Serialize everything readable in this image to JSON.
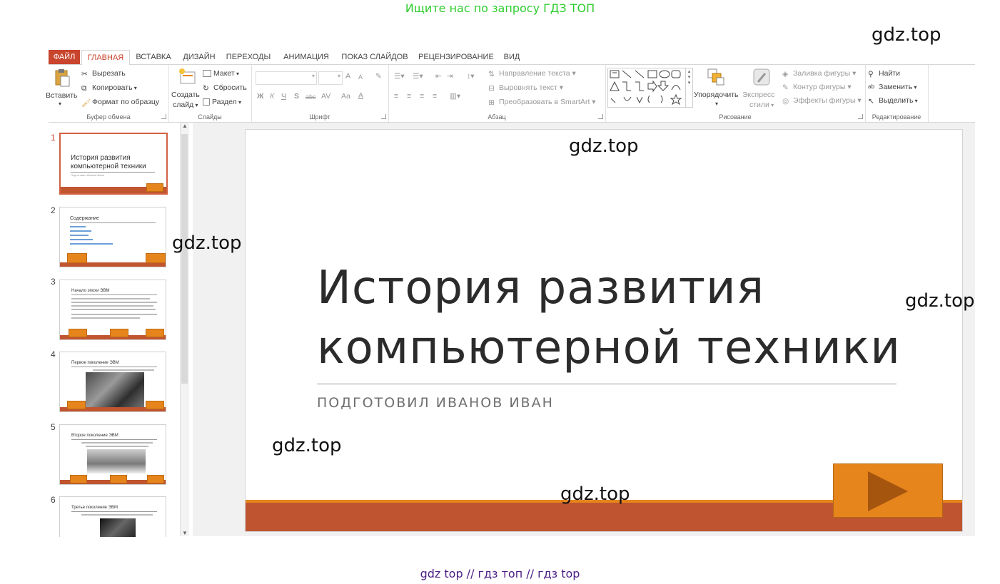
{
  "banner_top": "Ищите нас по запросу ГДЗ ТОП",
  "banner_bottom": "gdz top  //  гдз топ  //  гдз top",
  "watermark": "gdz.top",
  "ribbon": {
    "tabs": [
      "ФАЙЛ",
      "ГЛАВНАЯ",
      "ВСТАВКА",
      "ДИЗАЙН",
      "ПЕРЕХОДЫ",
      "АНИМАЦИЯ",
      "ПОКАЗ СЛАЙДОВ",
      "РЕЦЕНЗИРОВАНИЕ",
      "ВИД"
    ],
    "clipboard": {
      "paste": "Вставить",
      "cut": "Вырезать",
      "copy": "Копировать",
      "format_painter": "Формат по образцу",
      "label": "Буфер обмена"
    },
    "slides": {
      "new_slide_1": "Создать",
      "new_slide_2": "слайд",
      "layout": "Макет",
      "reset": "Сбросить",
      "section": "Раздел",
      "label": "Слайды"
    },
    "font": {
      "bold": "Ж",
      "italic": "К",
      "underline": "Ч",
      "shadow": "S",
      "strike": "abc",
      "spacing": "AV",
      "case": "Aa",
      "color": "A",
      "grow": "A",
      "shrink": "A",
      "label": "Шрифт"
    },
    "paragraph": {
      "text_direction": "Направление текста",
      "align_text": "Выровнять текст",
      "smartart": "Преобразовать в SmartArt",
      "label": "Абзац"
    },
    "drawing": {
      "arrange": "Упорядочить",
      "quick_styles_1": "Экспресс",
      "quick_styles_2": "стили",
      "fill": "Заливка фигуры",
      "outline": "Контур фигуры",
      "effects": "Эффекты фигуры",
      "label": "Рисование"
    },
    "editing": {
      "find": "Найти",
      "replace": "Заменить",
      "select": "Выделить",
      "label": "Редактирование"
    }
  },
  "thumbnails": [
    {
      "num": "1",
      "title": "История развития",
      "title2": "компьютерной техники",
      "sub": "Подготовил Иванов Иван"
    },
    {
      "num": "2",
      "title": "Содержание"
    },
    {
      "num": "3",
      "title": "Начало эпохи ЭВМ"
    },
    {
      "num": "4",
      "title": "Первое поколение ЭВМ"
    },
    {
      "num": "5",
      "title": "Второе поколение ЭВМ"
    },
    {
      "num": "6",
      "title": "Третье поколение ЭВМ"
    }
  ],
  "slide": {
    "title_line1": "История развития",
    "title_line2": "компьютерной техники",
    "subtitle": "ПОДГОТОВИЛ ИВАНОВ ИВАН"
  },
  "colors": {
    "accent": "#c9452d",
    "bar": "#be5530",
    "button": "#e5851c",
    "banner_top": "#2ecc2e",
    "banner_bottom": "#4b1d86"
  }
}
